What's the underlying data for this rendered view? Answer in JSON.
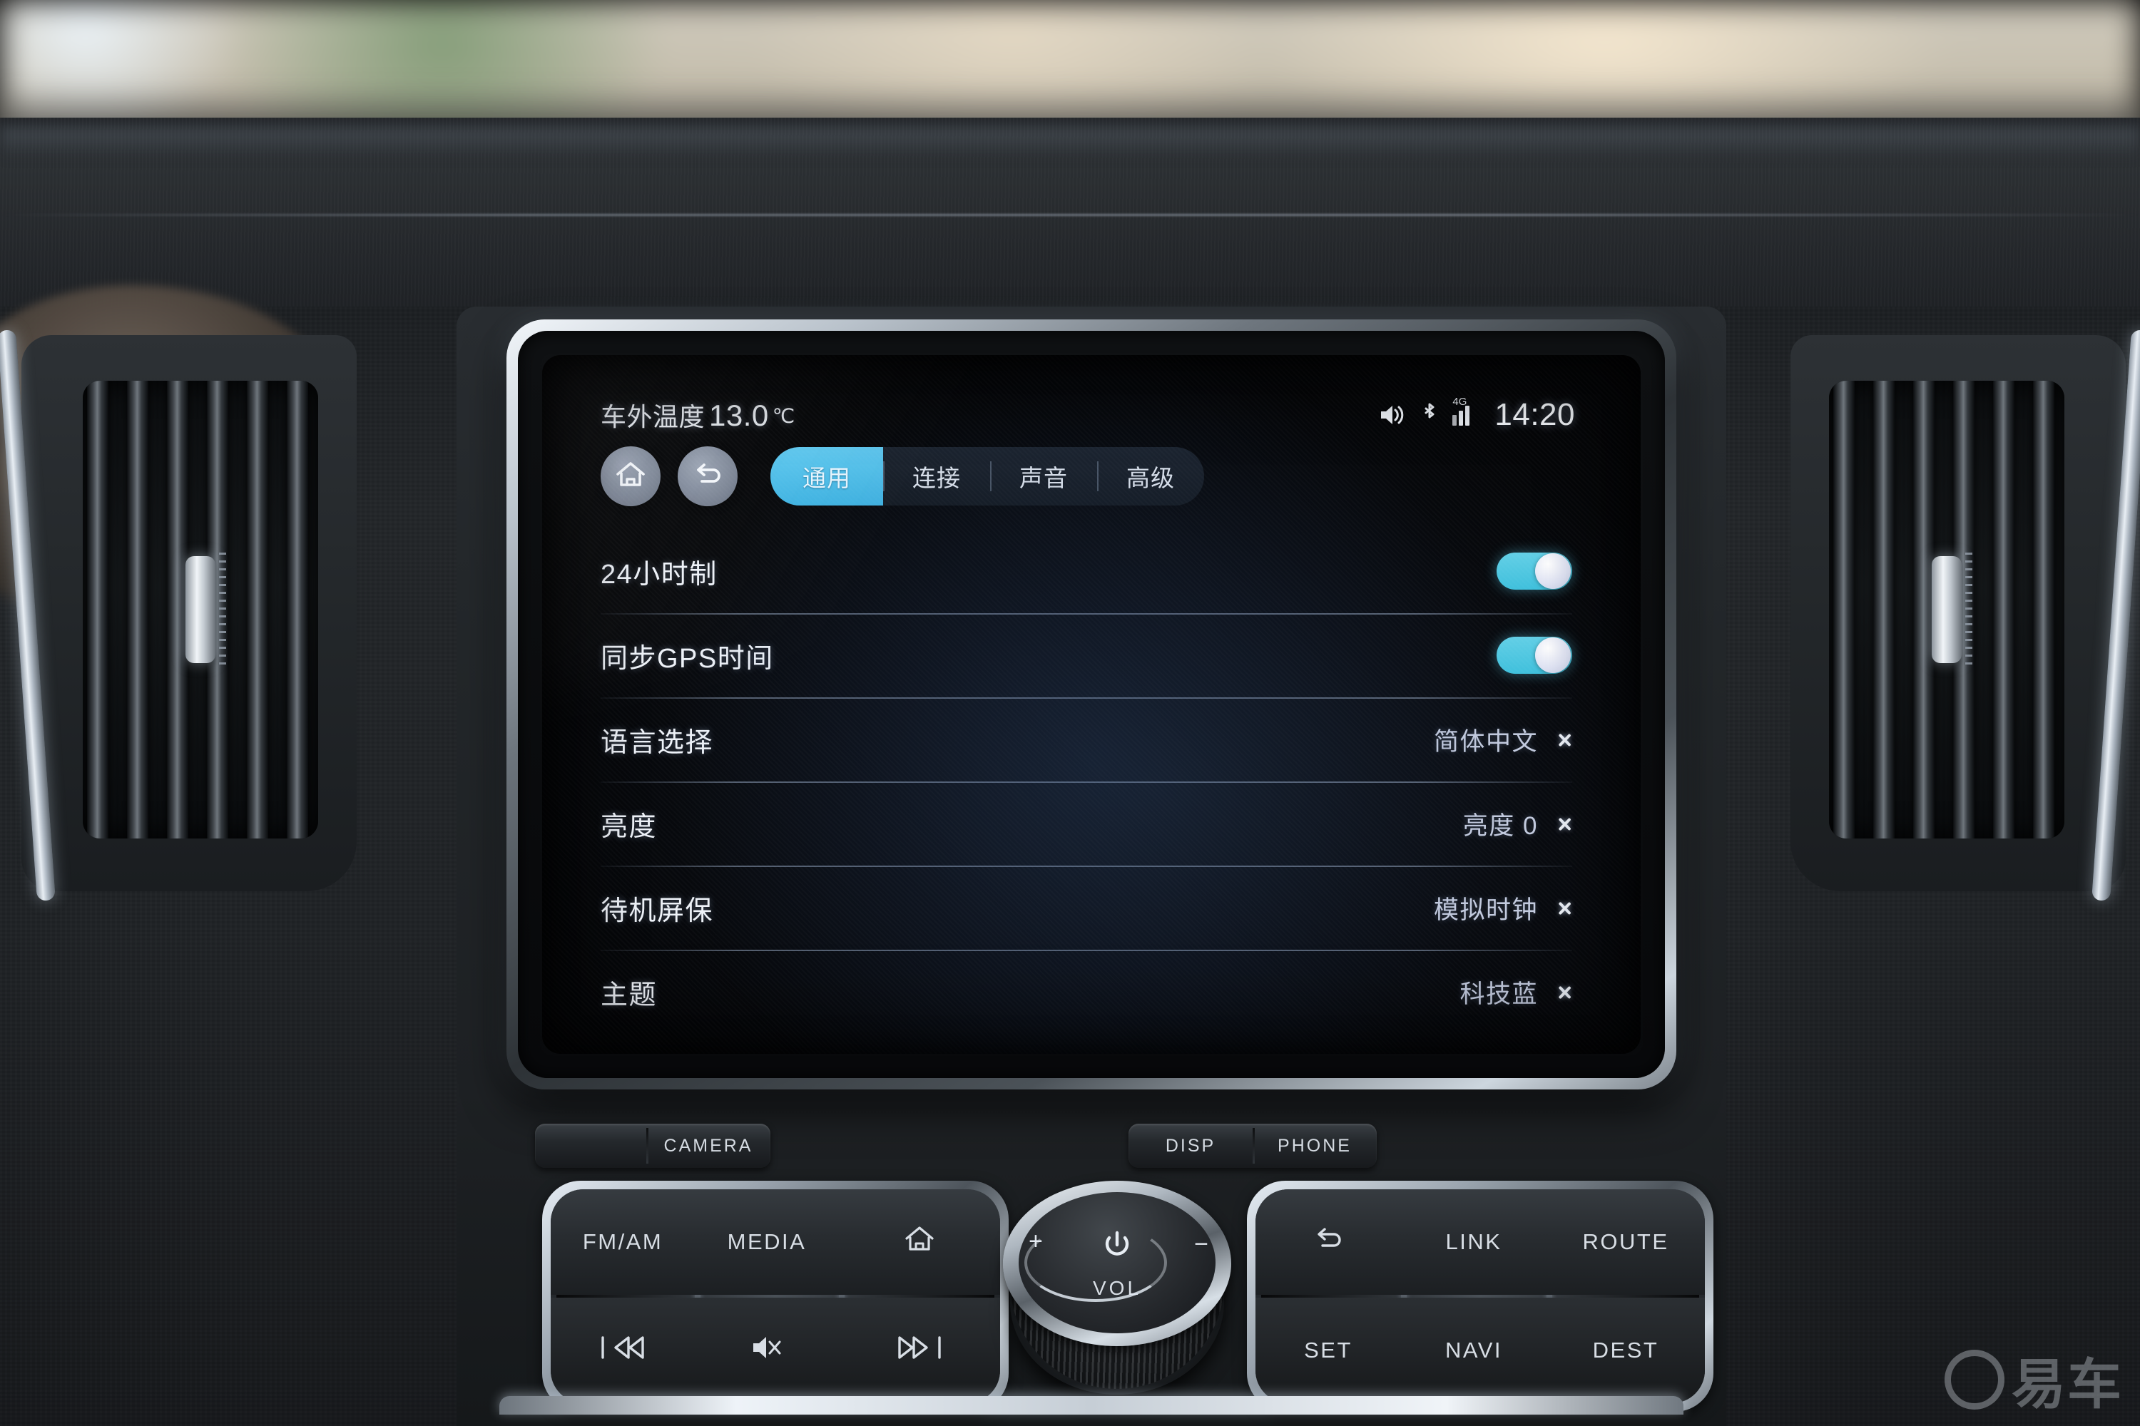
{
  "screen": {
    "statusbar": {
      "temperature_label": "车外温度",
      "temperature_value": "13.0",
      "temperature_unit": "℃",
      "clock": "14:20",
      "network_label": "4G",
      "icons": [
        "volume-icon",
        "bluetooth-icon",
        "signal-icon"
      ]
    },
    "nav": {
      "home_label": "home-icon",
      "back_label": "back-icon"
    },
    "tabs": [
      {
        "label": "通用",
        "active": true
      },
      {
        "label": "连接",
        "active": false
      },
      {
        "label": "声音",
        "active": false
      },
      {
        "label": "高级",
        "active": false
      }
    ],
    "settings_rows": [
      {
        "label": "24小时制",
        "type": "toggle",
        "value": "on"
      },
      {
        "label": "同步GPS时间",
        "type": "toggle",
        "value": "on"
      },
      {
        "label": "语言选择",
        "type": "link",
        "value": "简体中文"
      },
      {
        "label": "亮度",
        "type": "link",
        "value": "亮度 0"
      },
      {
        "label": "待机屏保",
        "type": "link",
        "value": "模拟时钟"
      },
      {
        "label": "主题",
        "type": "link",
        "value": "科技蓝"
      }
    ],
    "colors": {
      "accent_blue": "#3fb4e3",
      "toggle_on": "#4ec5de",
      "text_primary": "#eef2f8",
      "text_value": "#c2cade",
      "screen_bg": "#050608"
    }
  },
  "hardware": {
    "top_buttons_left": [
      "",
      "CAMERA"
    ],
    "top_buttons_right": [
      "DISP",
      "PHONE"
    ],
    "left_panel": {
      "upper": [
        "FM/AM",
        "MEDIA",
        "home-icon"
      ],
      "lower": [
        "prev-track-icon",
        "mute-icon",
        "next-track-icon"
      ]
    },
    "right_panel": {
      "upper": [
        "back-icon",
        "LINK",
        "ROUTE"
      ],
      "lower": [
        "SET",
        "NAVI",
        "DEST"
      ]
    },
    "volume_knob": {
      "label": "VOL",
      "power_icon": "power-icon",
      "increase": "+",
      "decrease": "−"
    }
  },
  "watermark": {
    "text": "易车"
  }
}
